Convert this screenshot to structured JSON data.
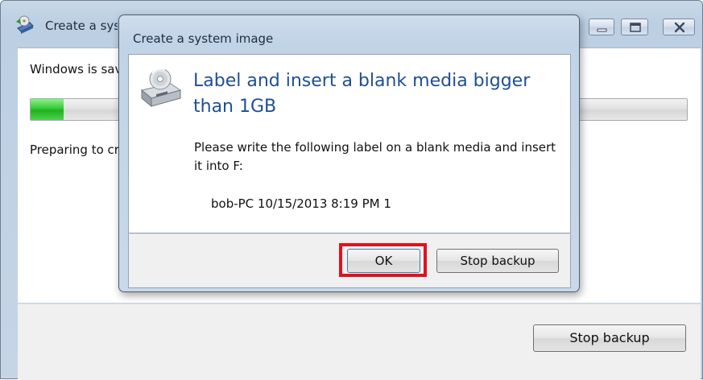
{
  "main_window": {
    "title": "Create a system image",
    "status_text": "Windows is saving the backup...",
    "progress_fraction": 0.05,
    "preparing_text": "Preparing to create a backup...",
    "stop_button_label": "Stop backup",
    "caption_buttons": {
      "minimize_icon": "minimize-icon",
      "maximize_icon": "maximize-icon",
      "close_icon": "close-icon"
    }
  },
  "dialog": {
    "title": "Create a system image",
    "icon": "optical-drive-icon",
    "heading": "Label and insert a blank media bigger than 1GB",
    "instruction": "Please write the following label on a blank media and insert it into F:",
    "media_label": "bob-PC 10/15/2013 8:19 PM  1",
    "ok_label": "OK",
    "stop_label": "Stop backup",
    "highlight_color": "#e0121e"
  },
  "colors": {
    "heading_blue": "#1f4e95",
    "progress_green": "#1fb21f"
  }
}
